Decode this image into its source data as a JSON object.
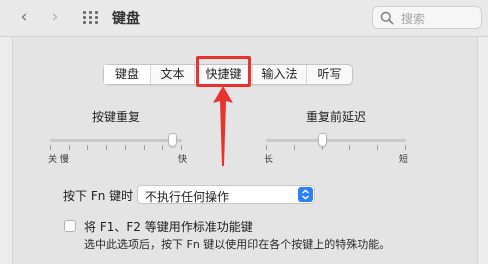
{
  "window": {
    "title": "键盘"
  },
  "search": {
    "placeholder": "搜索"
  },
  "tabs": [
    {
      "label": "键盘",
      "active": true
    },
    {
      "label": "文本",
      "active": false
    },
    {
      "label": "快捷键",
      "active": false,
      "highlighted": true
    },
    {
      "label": "输入法",
      "active": false
    },
    {
      "label": "听写",
      "active": false
    }
  ],
  "key_repeat": {
    "label": "按键重复",
    "min_label": "关 慢",
    "max_label": "快",
    "steps": 8,
    "level": 0.93
  },
  "repeat_delay": {
    "label": "重复前延迟",
    "min_label": "长",
    "max_label": "短",
    "steps": 6,
    "level": 0.4
  },
  "fn_key": {
    "label": "按下 Fn 键时",
    "selected": "不执行任何操作"
  },
  "fkeys_option": {
    "label": "将 F1、F2 等键用作标准功能键",
    "checked": false,
    "description": "选中此选项后，按下 Fn 键以使用印在各个按键上的特殊功能。"
  },
  "colors": {
    "highlight": "#e8322e",
    "accent": "#2d7ff5"
  }
}
